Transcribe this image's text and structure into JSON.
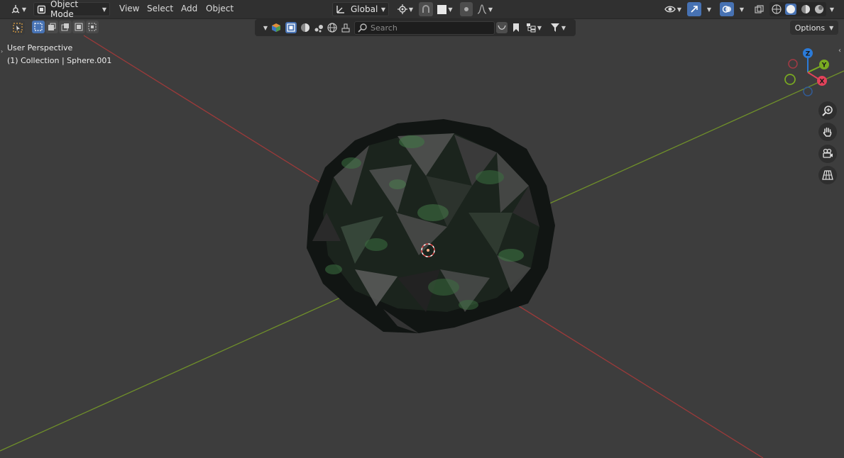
{
  "header": {
    "mode_label": "Object Mode",
    "menus": [
      "View",
      "Select",
      "Add",
      "Object"
    ],
    "transform_orientation": "Global"
  },
  "outliner_filter": {
    "search_placeholder": "Search"
  },
  "options_label": "Options",
  "viewport": {
    "view_name": "User Perspective",
    "collection_info": "(1) Collection | Sphere.001"
  },
  "gizmo": {
    "z_label": "Z",
    "y_label": "Y",
    "x_label": "X"
  },
  "colors": {
    "x_axis": "#9c3a3a",
    "y_axis": "#6f8f2a",
    "gizmo_x": "#e3425a",
    "gizmo_y": "#7aab21",
    "gizmo_z": "#2b7bd9",
    "accent": "#4772b3"
  },
  "icons": [
    "editor-type-icon",
    "object-mode-icon",
    "transform-orientation-icon",
    "pivot-icon",
    "snap-icon",
    "proportional-edit-icon",
    "select-box-icon",
    "visibility-icon",
    "gizmo-icon",
    "overlay-icon",
    "xray-icon",
    "wireframe-shading-icon",
    "solid-shading-icon",
    "material-shading-icon",
    "rendered-shading-icon",
    "zoom-icon",
    "pan-hand-icon",
    "camera-view-icon",
    "ortho-grid-icon"
  ]
}
